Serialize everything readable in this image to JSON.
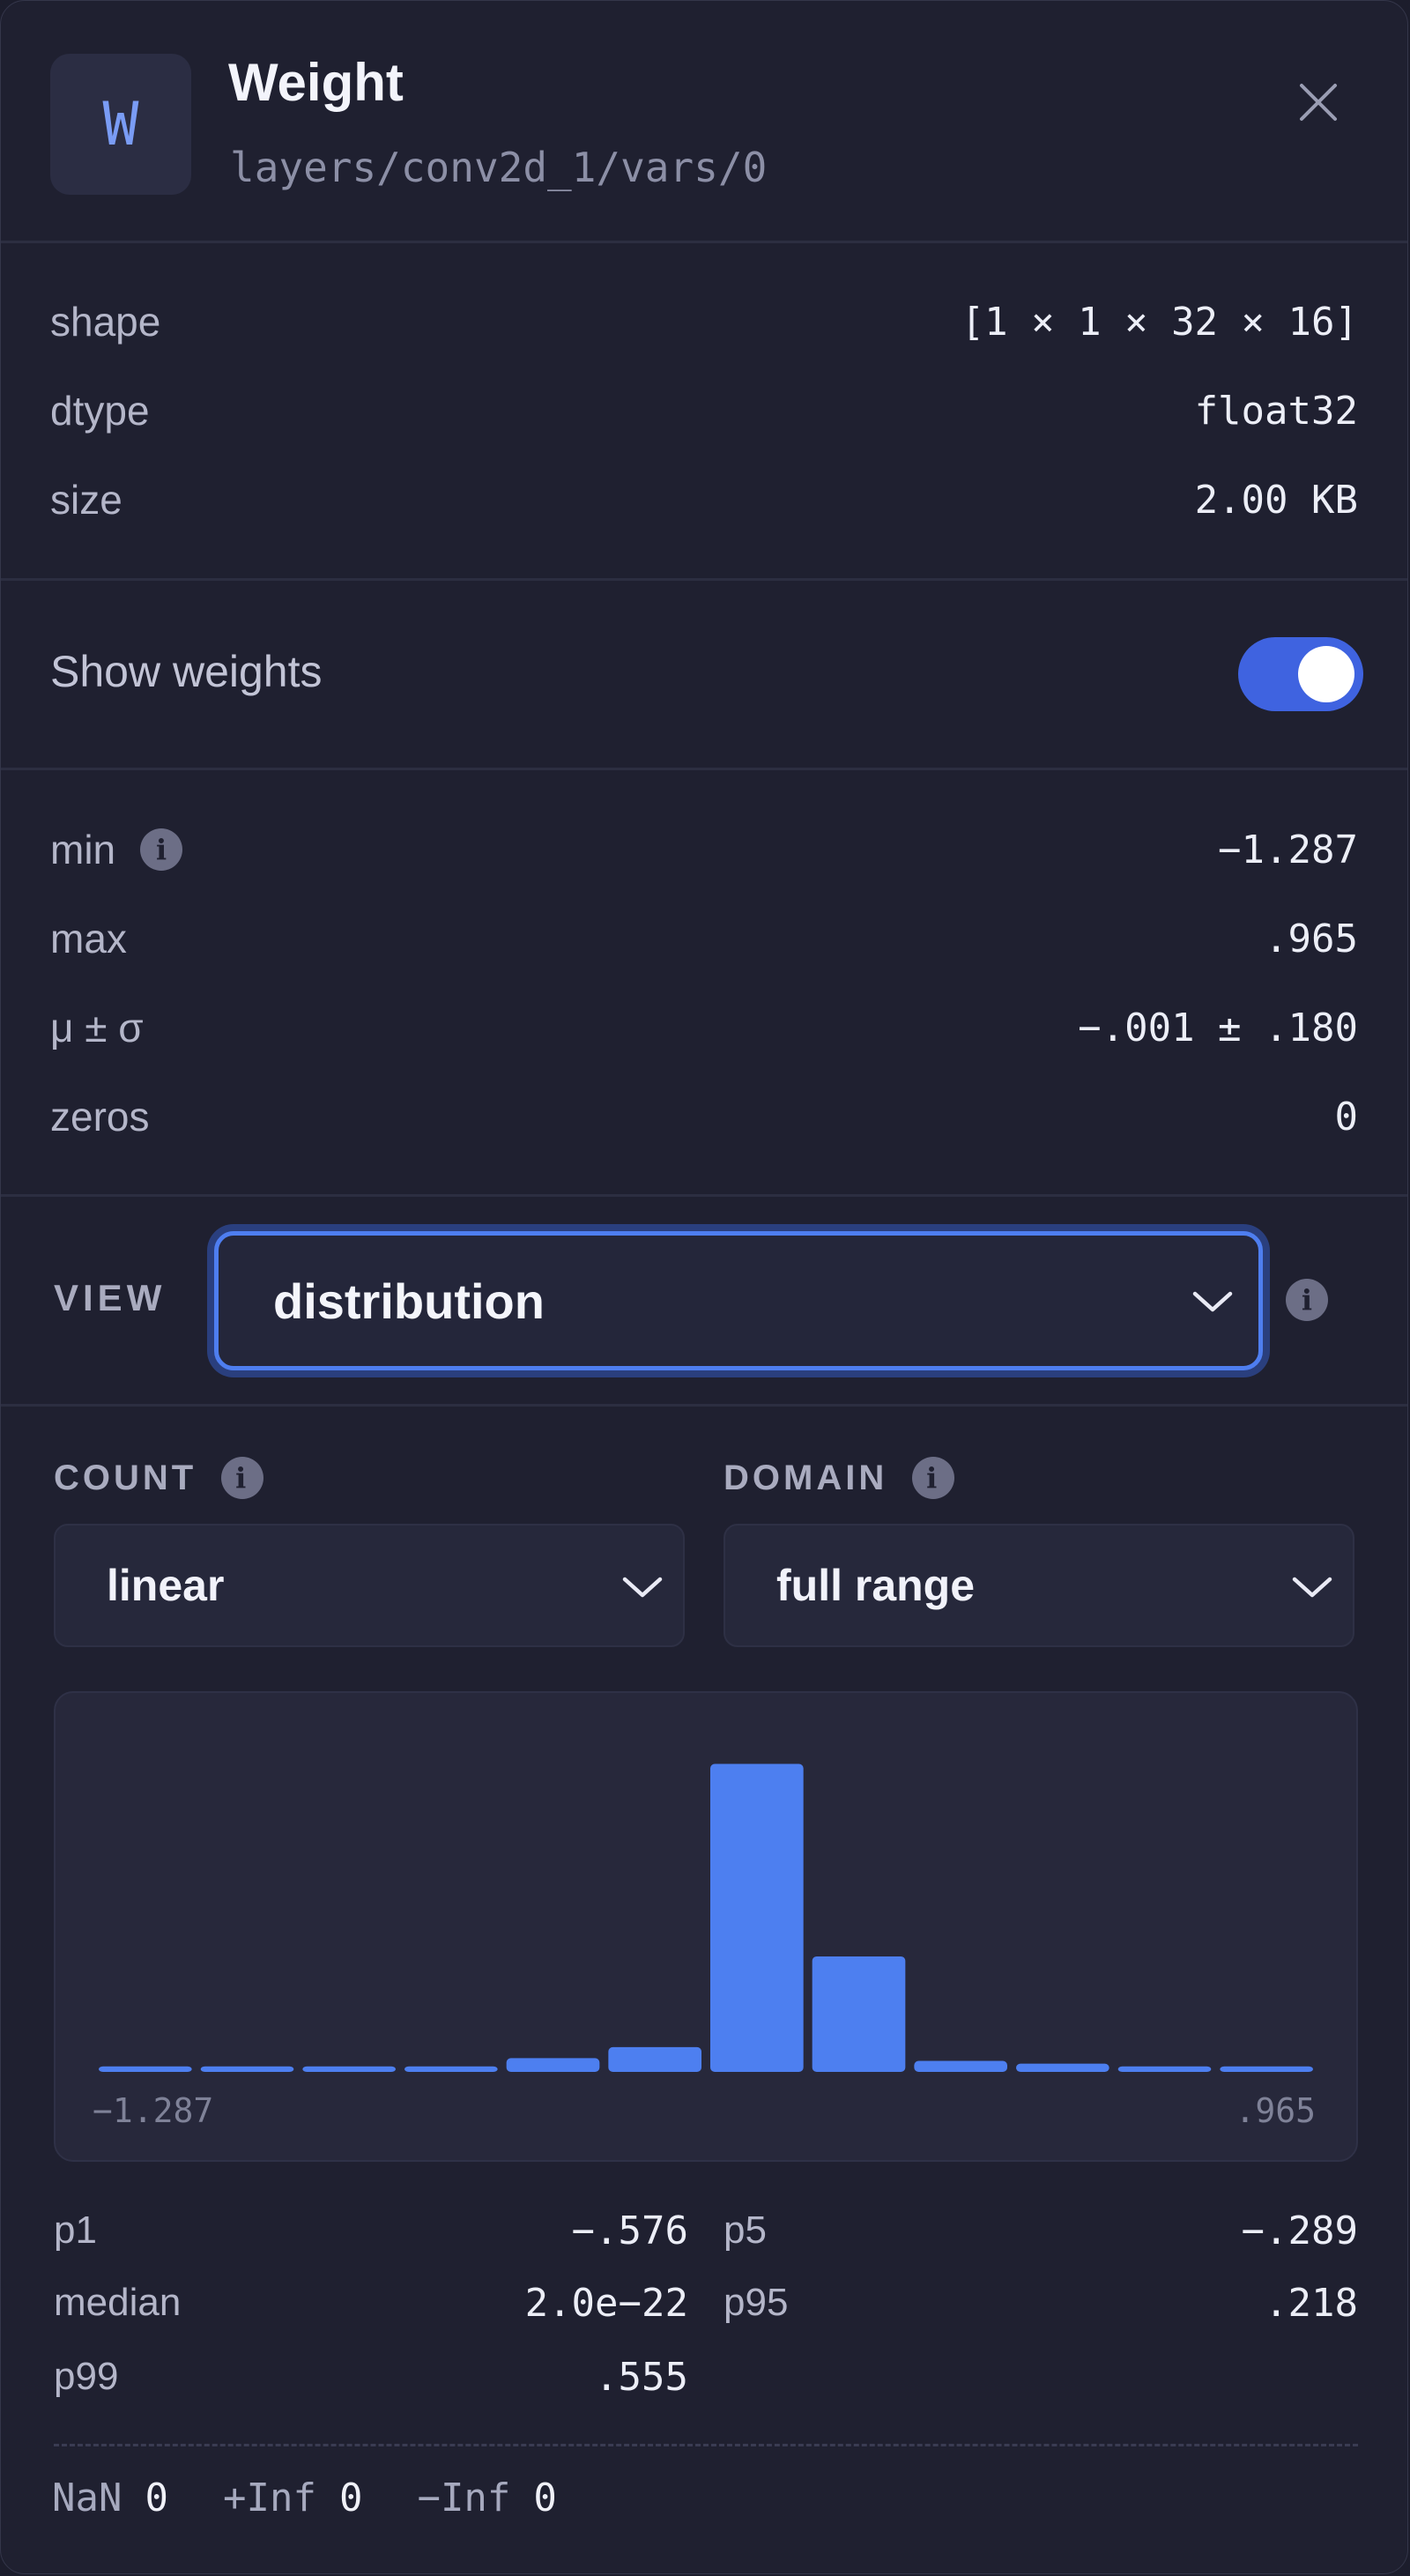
{
  "header": {
    "badge_letter": "W",
    "title": "Weight",
    "path": "layers/conv2d_1/vars/0",
    "close_icon": "close-icon"
  },
  "info": {
    "shape_label": "shape",
    "shape_value": "[1 × 1 × 32 × 16]",
    "dtype_label": "dtype",
    "dtype_value": "float32",
    "size_label": "size",
    "size_value": "2.00 KB"
  },
  "toggle": {
    "label": "Show weights",
    "on": true
  },
  "stats": {
    "min_label": "min",
    "min_value": "−1.287",
    "max_label": "max",
    "max_value": ".965",
    "mean_label": "μ ± σ",
    "mean_value": "−.001 ± .180",
    "zeros_label": "zeros",
    "zeros_value": "0"
  },
  "view": {
    "label": "VIEW",
    "selected": "distribution"
  },
  "count": {
    "label": "COUNT",
    "selected": "linear"
  },
  "domain": {
    "label": "DOMAIN",
    "selected": "full range"
  },
  "colors": {
    "accent": "#4f7ff0",
    "bar": "#4d7ff0",
    "background": "#1f2030"
  },
  "chart_data": {
    "type": "bar",
    "title": "",
    "x_min_label": "−1.287",
    "x_max_label": ".965",
    "xlim": [
      -1.287,
      0.965
    ],
    "bins": 12,
    "values": [
      2,
      2,
      2,
      2,
      5,
      9,
      112,
      42,
      4,
      3,
      2,
      2
    ],
    "ylim": [
      0,
      125
    ],
    "grid": false
  },
  "percentiles": {
    "p1_label": "p1",
    "p1_value": "−.576",
    "p5_label": "p5",
    "p5_value": "−.289",
    "median_label": "median",
    "median_value": "2.0e−22",
    "p95_label": "p95",
    "p95_value": ".218",
    "p99_label": "p99",
    "p99_value": ".555"
  },
  "footer": {
    "nan_label": "NaN",
    "nan_value": "0",
    "pinf_label": "+Inf",
    "pinf_value": "0",
    "ninf_label": "−Inf",
    "ninf_value": "0"
  }
}
